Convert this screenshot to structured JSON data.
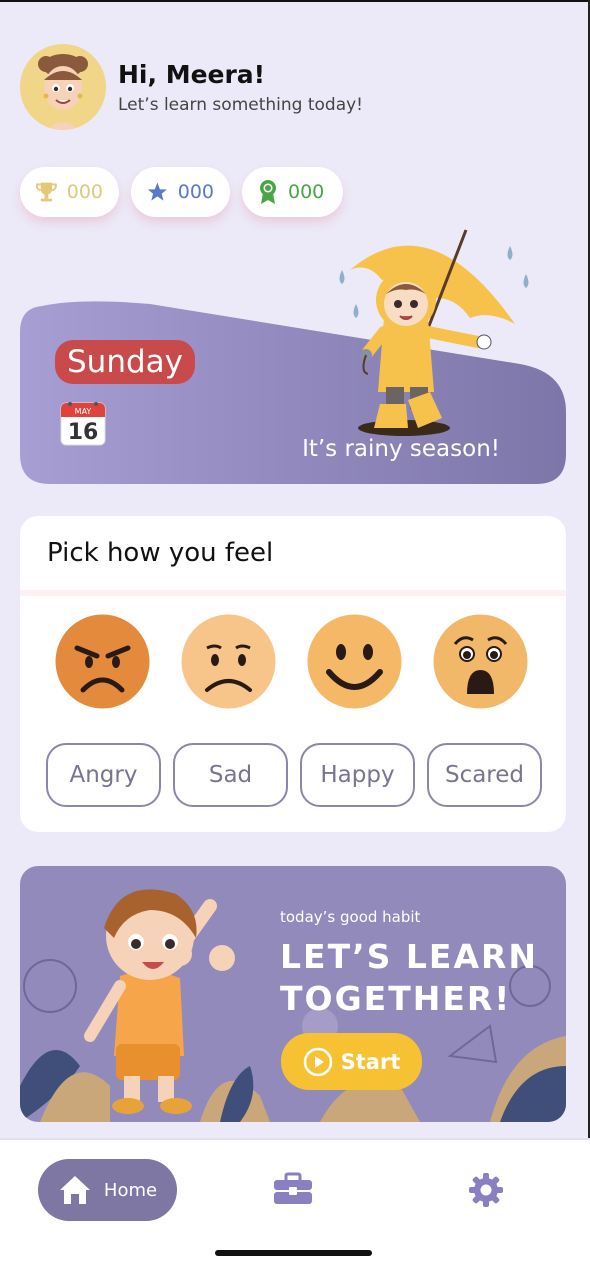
{
  "header": {
    "greeting": "Hi, Meera!",
    "subtitle": "Let’s learn something today!"
  },
  "stats": {
    "trophies": "000",
    "stars": "000",
    "badges": "000"
  },
  "weather": {
    "day": "Sunday",
    "calendar_month": "MAY",
    "calendar_day": "16",
    "message": "It’s rainy season!"
  },
  "feel": {
    "title": "Pick how you feel",
    "moods": [
      "Angry",
      "Sad",
      "Happy",
      "Scared"
    ]
  },
  "habit": {
    "subtitle": "today’s good habit",
    "title_line1": "LET’S LEARN",
    "title_line2": "TOGETHER!",
    "start_label": "Start"
  },
  "nav": {
    "home_label": "Home",
    "items": [
      "home-icon",
      "toolbox-icon",
      "gear-icon"
    ]
  },
  "colors": {
    "background": "#eceaf8",
    "accent_purple": "#7e77a3",
    "day_pill": "#c94a4a",
    "start_button": "#f6c234",
    "trophy": "#e3c878",
    "star": "#5a79c8",
    "badge": "#4aa54a"
  }
}
